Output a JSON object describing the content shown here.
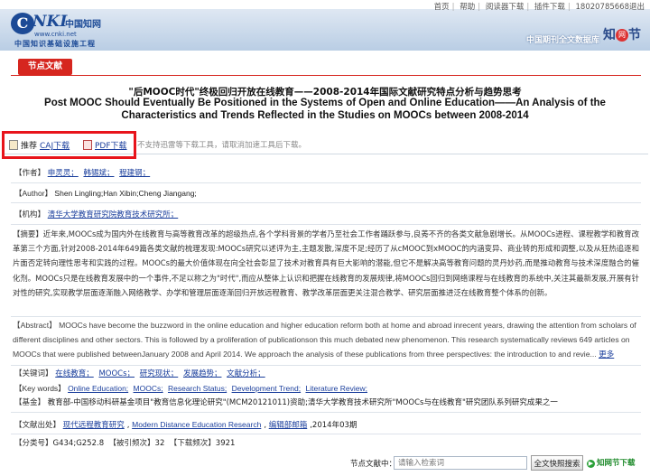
{
  "header": {
    "toplinks": [
      "首页",
      "帮助",
      "阅读器下载",
      "插件下载",
      "18020785668退出"
    ],
    "logo": {
      "badge": "C",
      "word": "NKI",
      "cn": "中国知网",
      "url": "www.cnki.net",
      "org": "中国知识基础设施工程"
    },
    "db_name": "中国期刊全文数据库",
    "db_mark": {
      "a": "知",
      "b": "网",
      "c": "节"
    }
  },
  "tab_label": "节点文献",
  "title_cn": "\"后MOOC时代\"终极回归开放在线教育——2008-2014年国际文献研究特点分析与趋势思考",
  "title_en": "Post MOOC Should Eventually Be Positioned in the Systems of Open and Online Education——An Analysis of the Characteristics and Trends Reflected in the Studies on MOOCs between 2008-2014",
  "download": {
    "recommend": "推荐",
    "caj": "CAJ下载",
    "pdf": "PDF下载",
    "note": "不支持迅雷等下载工具，请取消加速工具后下载。"
  },
  "authors": {
    "label": "【作者】",
    "names": [
      "申灵灵；",
      "韩锡斌；",
      "程建钢；"
    ]
  },
  "author_en": {
    "label": "【Author】",
    "text": "Shen Lingling;Han Xibin;Cheng Jiangang;"
  },
  "institution": {
    "label": "【机构】",
    "name": "清华大学教育研究院教育技术研究所；"
  },
  "abstract_cn": {
    "label": "【摘要】",
    "text": "近年来,MOOCs成为国内外在线教育与高等教育改革的超级热点,各个学科背景的学者乃至社会工作者踊跃参与,良莠不齐的各类文献急剧增长。从MOOCs进程、课程教学和教育改革第三个方面,针对2008-2014年649篇各类文献的梳理发现:MOOCs研究以述评为主,主题发散,深度不足;经历了从cMOOC到xMOOC的内涵变异、商业转的形成和调整,以及从狂热追逐和片面否定转向理性思考和实践的过程。MOOCs的最大价值体现在向全社会彰显了技术对教育具有巨大影响的潜能,但它不是解决高等教育问题的灵丹妙药,而是推动教育与技术深度融合的催化剂。MOOCs只是在线教育发展中的一个事件,不足以称之为\"时代\",而应从整体上认识和把握在线教育的发展规律,将MOOCs回归到网络课程与在线教育的系统中,关注其最新发展,开展有针对性的研究,实现教学层面逐渐融入网络教学、办学和管理层面逐渐回归开放远程教育、教学改革层面更关注混合教学、研究层面推进泛在线教育整个体系的创新。"
  },
  "abstract_en": {
    "label": "【Abstract】",
    "text": "MOOCs have become the buzzword in the online education and higher education reform both at home and abroad inrecent years, drawing the attention from scholars of different disciplines and other sectors. This is followed by a proliferation of publicationson this much debated new phenomenon. This research systematically reviews 649 articles on MOOCs that were published betweenJanuary 2008 and April 2014. We approach the analysis of these publications from three perspectives: the introduction to and revie...",
    "more": "更多"
  },
  "keywords_cn": {
    "label": "【关键词】",
    "items": [
      "在线教育；",
      "MOOCs；",
      "研究现状；",
      "发展趋势；",
      "文献分析；"
    ]
  },
  "keywords_en": {
    "label": "【Key words】",
    "items": [
      "Online Education;",
      "MOOCs;",
      "Research Status;",
      "Development Trend;",
      "Literature Review;"
    ]
  },
  "fund": {
    "label": "【基金】",
    "text": "教育部-中国移动科研基金项目\"教育信息化理论研究\"(MCM20121011)资助;清华大学教育技术研究所\"MOOCs与在线教育\"研究团队系列研究成果之一"
  },
  "source": {
    "label": "【文献出处】",
    "journal_cn": "现代远程教育研究",
    "journal_en": "Modern Distance Education Research",
    "dept": "编辑部邮箱",
    "issue": ",2014年03期"
  },
  "stats": {
    "class_label": "【分类号】",
    "class_value": "G434;G252.8",
    "cited_label": "【被引频次】",
    "cited_value": "32",
    "download_label": "【下载频次】",
    "download_value": "3921"
  },
  "footer": {
    "label": "节点文献中：",
    "placeholder": "请输入检索词",
    "search_button": "全文快照搜索",
    "node_link": "知网节下载"
  }
}
